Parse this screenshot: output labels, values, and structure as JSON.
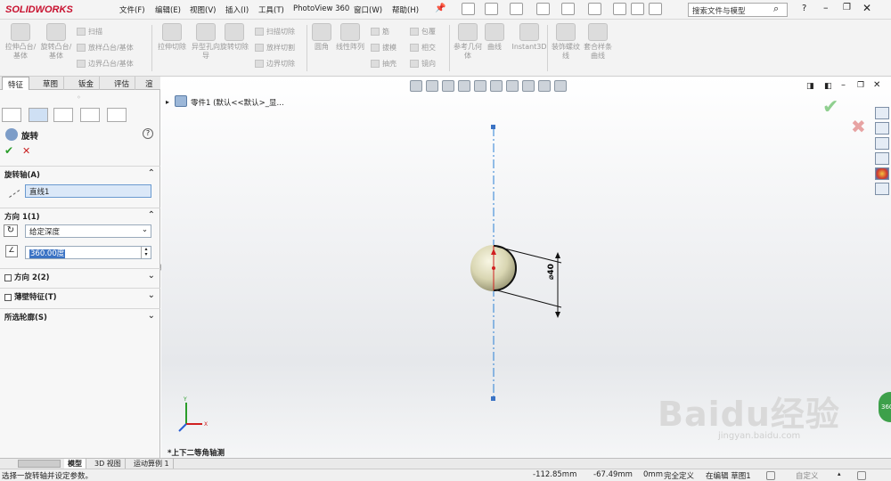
{
  "app": {
    "logo": "SOLIDWORKS"
  },
  "menu": [
    "文件(F)",
    "编辑(E)",
    "视图(V)",
    "插入(I)",
    "工具(T)",
    "PhotoView 360",
    "窗口(W)",
    "帮助(H)"
  ],
  "search": {
    "placeholder": "搜索文件与模型"
  },
  "ribbon": {
    "big": [
      "拉伸凸台/基体",
      "旋转凸台/基体",
      "拉伸切除",
      "异型孔向导",
      "旋转切除",
      "圆角",
      "线性阵列",
      "参考几何体",
      "曲线",
      "Instant3D",
      "装饰螺纹线",
      "套合样条曲线"
    ],
    "small": [
      "扫描",
      "放样凸台/基体",
      "边界凸台/基体",
      "扫描切除",
      "放样切割",
      "边界切除",
      "筋",
      "拔模",
      "抽壳",
      "包覆",
      "相交",
      "镜向"
    ]
  },
  "tabs": [
    "特征",
    "草图",
    "钣金",
    "评估",
    "渲染工具"
  ],
  "feature": {
    "title": "旋转",
    "axis_section": "旋转轴(A)",
    "axis_value": "直线1",
    "dir1_section": "方向 1(1)",
    "dir1_type": "给定深度",
    "angle_value": "360.00度",
    "dir2_section": "方向 2(2)",
    "thin_section": "薄壁特征(T)",
    "contours_section": "所选轮廓(S)"
  },
  "viewport": {
    "tree_item": "零件1 (默认<<默认>_显...",
    "view_label": "*上下二等角轴测",
    "dimension": "⌀40"
  },
  "bottom_tabs": [
    "模型",
    "3D 视图",
    "运动算例 1"
  ],
  "status": {
    "message": "选择一旋转轴并设定参数。",
    "x": "-112.85mm",
    "y": "-67.49mm",
    "z": "0mm",
    "state": "完全定义",
    "editing": "在编辑 草图1",
    "units": "自定义"
  },
  "watermark": {
    "text": "Baidu经验",
    "url": "jingyan.baidu.com"
  },
  "colors": {
    "brand": "#c8102e",
    "accept": "#2a9d2a",
    "cancel": "#c82020",
    "axis": "#2a7fd4"
  }
}
